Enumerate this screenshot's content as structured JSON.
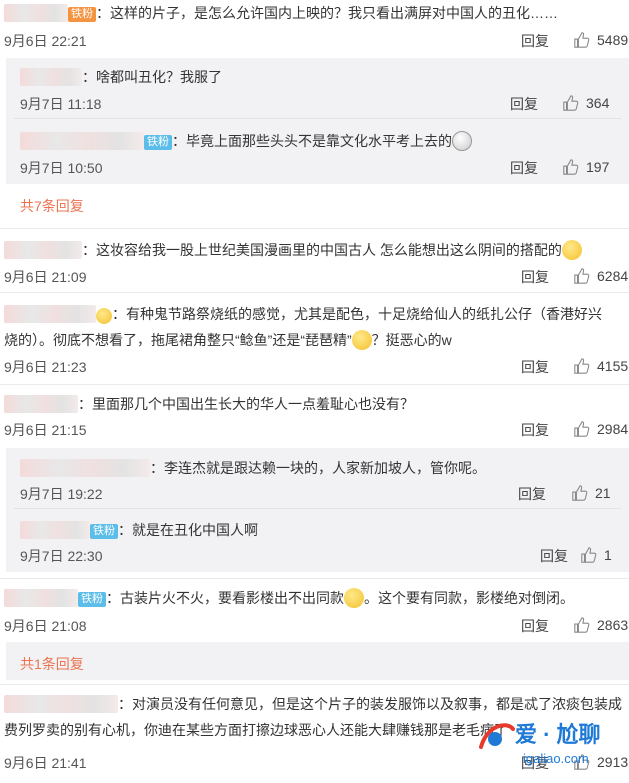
{
  "comments": [
    {
      "text": "：这样的片子，是怎么允许国内上映的？我只看出满屏对中国人的丑化……",
      "time": "9月6日 22:21",
      "reply": "回复",
      "likes": "5489",
      "badge": "铁粉"
    },
    {
      "sub1": {
        "text": "：啥都叫丑化？我服了",
        "time": "9月7日 11:18",
        "reply": "回复",
        "likes": "364"
      },
      "sub2": {
        "badge": "铁粉",
        "text": "：毕竟上面那些头头不是靠文化水平考上去的",
        "time": "9月7日 10:50",
        "reply": "回复",
        "likes": "197"
      },
      "more": "共7条回复"
    },
    {
      "text": "：这妆容给我一股上世纪美国漫画里的中国古人 怎么能想出这么阴间的搭配的",
      "time": "9月6日 21:09",
      "reply": "回复",
      "likes": "6284"
    },
    {
      "line1": "：有种鬼节路祭烧纸的感觉，尤其是配色，十足烧给仙人的纸扎公仔（香港好兴",
      "line2a": "烧的）。彻底不想看了，拖尾裙角整只“鲶鱼”还是“琵琶精”",
      "line2b": "？挺恶心的w",
      "time": "9月6日 21:23",
      "reply": "回复",
      "likes": "4155"
    },
    {
      "text": "：里面那几个中国出生长大的华人一点羞耻心也没有？",
      "time": "9月6日 21:15",
      "reply": "回复",
      "likes": "2984",
      "sub1": {
        "text": "：李连杰就是跟达赖一块的，人家新加坡人，管你呢。",
        "time": "9月7日 19:22",
        "reply": "回复",
        "likes": "21"
      },
      "sub2": {
        "badge": "铁粉",
        "text": "：就是在丑化中国人啊",
        "time": "9月7日 22:30",
        "reply": "回复",
        "likes": "1"
      }
    },
    {
      "badge": "铁粉",
      "text1": "：古装片火不火，要看影楼出不出同款",
      "text2": "。这个要有同款，影楼绝对倒闭。",
      "time": "9月6日 21:08",
      "reply": "回复",
      "likes": "2863",
      "more": "共1条回复"
    },
    {
      "line1": "：对演员没有任何意见，但是这个片子的装发服饰以及叙事，都是忒了浓痰包装成",
      "line2": "费列罗卖的别有心机，你迪在某些方面打擦边球恶心人还能大肆赚钱那是老毛病了",
      "time": "9月6日 21:41",
      "reply": "回复",
      "likes": "2913"
    }
  ],
  "watermark": {
    "main": "爱 · 尬聊",
    "url": "igaliao.com"
  },
  "colors": {
    "accent": "#eb7350",
    "sub_bg": "#f2f2f5",
    "badge": "#5cbde8"
  }
}
